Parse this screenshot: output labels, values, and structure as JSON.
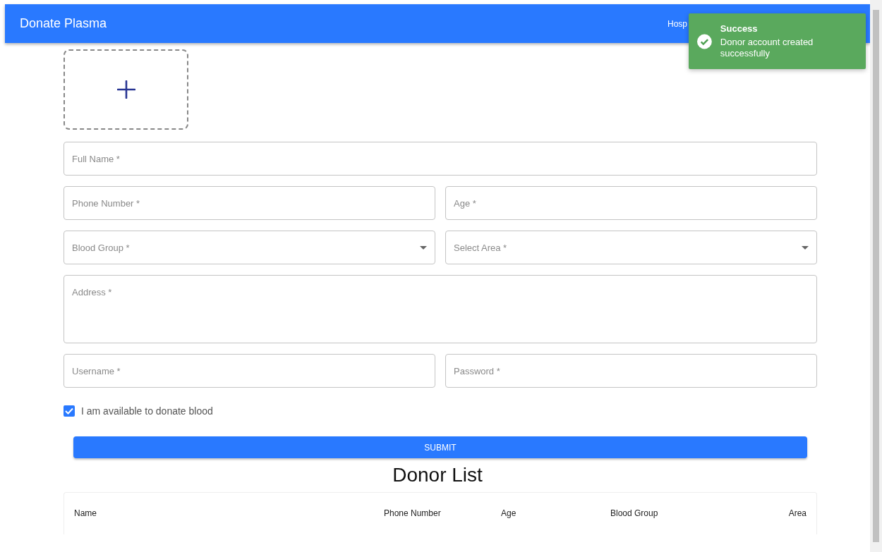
{
  "app_bar": {
    "title": "Donate Plasma",
    "links": [
      "Hosp"
    ]
  },
  "toast": {
    "kind": "success",
    "title": "Success",
    "message": "Donor account created successfully"
  },
  "form": {
    "rows": [
      [
        {
          "kind": "text",
          "placeholder": "Full Name *"
        }
      ],
      [
        {
          "kind": "text",
          "placeholder": "Phone Number *"
        },
        {
          "kind": "text",
          "placeholder": "Age *"
        }
      ],
      [
        {
          "kind": "select",
          "placeholder": "Blood Group *"
        },
        {
          "kind": "select",
          "placeholder": "Select Area *"
        }
      ],
      [
        {
          "kind": "textarea",
          "placeholder": "Address *"
        }
      ],
      [
        {
          "kind": "text",
          "placeholder": "Username *"
        },
        {
          "kind": "password",
          "placeholder": "Password *"
        }
      ]
    ],
    "checkbox": {
      "label": "I am available to donate blood",
      "checked": true
    },
    "submit": "SUBMIT"
  },
  "donor_list": {
    "title": "Donor List",
    "columns": [
      "Name",
      "Phone Number",
      "Age",
      "Blood Group",
      "Area"
    ]
  }
}
